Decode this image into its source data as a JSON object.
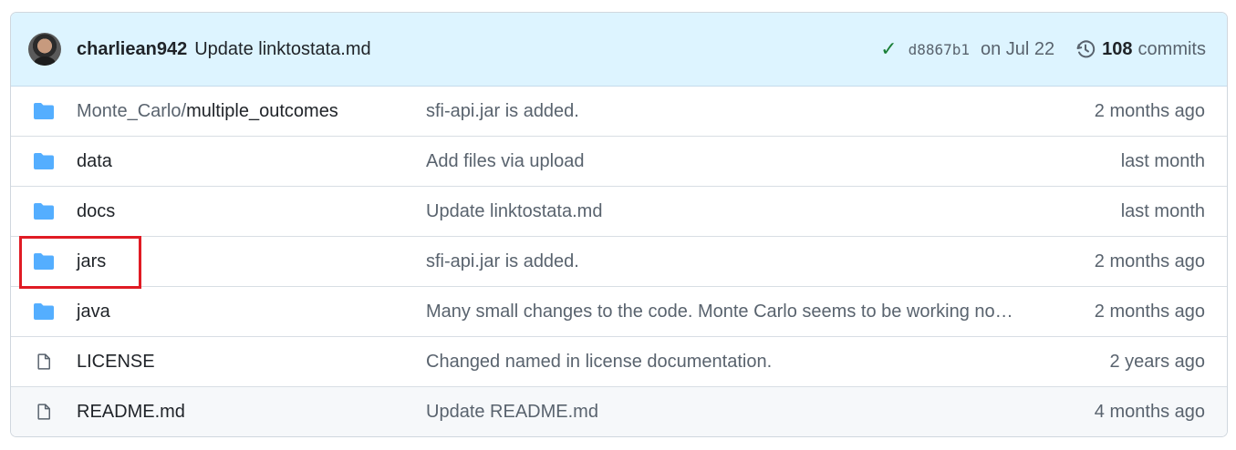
{
  "latest_commit": {
    "author": "charliean942",
    "message": "Update linktostata.md",
    "status_icon": "check-icon",
    "sha": "d8867b1",
    "date": "on Jul 22",
    "commits_count": "108",
    "commits_label": "commits"
  },
  "files": [
    {
      "type": "folder",
      "prefix": "Monte_Carlo/",
      "name": "multiple_outcomes",
      "message": "sfi-api.jar is added.",
      "age": "2 months ago"
    },
    {
      "type": "folder",
      "prefix": "",
      "name": "data",
      "message": "Add files via upload",
      "age": "last month"
    },
    {
      "type": "folder",
      "prefix": "",
      "name": "docs",
      "message": "Update linktostata.md",
      "age": "last month"
    },
    {
      "type": "folder",
      "prefix": "",
      "name": "jars",
      "message": "sfi-api.jar is added.",
      "age": "2 months ago"
    },
    {
      "type": "folder",
      "prefix": "",
      "name": "java",
      "message": "Many small changes to the code. Monte Carlo seems to be working no…",
      "age": "2 months ago"
    },
    {
      "type": "file",
      "prefix": "",
      "name": "LICENSE",
      "message": "Changed named in license documentation.",
      "age": "2 years ago"
    },
    {
      "type": "file",
      "prefix": "",
      "name": "README.md",
      "message": "Update README.md",
      "age": "4 months ago"
    }
  ],
  "colors": {
    "folder": "#54aeff",
    "highlight": "#e01b24",
    "commit_bar": "#ddf4ff",
    "check": "#1a7f37"
  }
}
